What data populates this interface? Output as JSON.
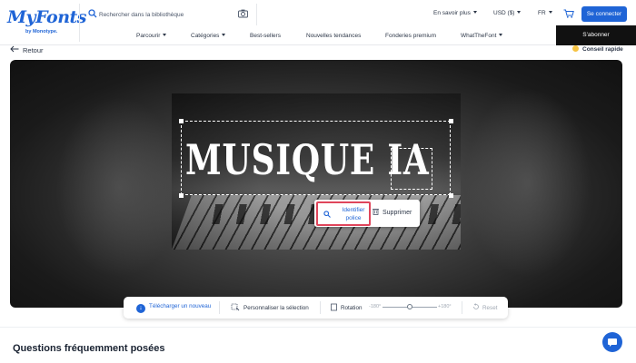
{
  "header": {
    "logo_main": "MyFonts",
    "logo_sub": "by Monotype.",
    "search_placeholder": "Rechercher dans la bibliothèque",
    "learn_more": "En savoir plus",
    "currency": "USD ($)",
    "language": "FR",
    "login": "Se connecter"
  },
  "menu": {
    "items": [
      "Parcourir",
      "Catégories",
      "Best-sellers",
      "Nouvelles tendances",
      "Fonderies premium",
      "WhatTheFont"
    ],
    "subscribe": "S'abonner"
  },
  "nav": {
    "back": "Retour",
    "quick_tip": "Conseil rapide"
  },
  "canvas": {
    "image_text": "MUSIQUE IA",
    "identify_label": "Identifier police",
    "delete_label": "Supprimer"
  },
  "toolbar": {
    "upload": "Télécharger un nouveau",
    "customize": "Personnaliser la sélection",
    "rotation": "Rotation",
    "rot_min": "-180°",
    "rot_max": "+180°",
    "reset": "Reset",
    "rotation_value": 0
  },
  "faq_title": "Questions fréquemment posées",
  "colors": {
    "brand_blue": "#1f64d6",
    "highlight_red": "#e0455b",
    "subscribe_bg": "#111111"
  },
  "icons": [
    "search-icon",
    "camera-icon",
    "cart-icon",
    "back-arrow-icon",
    "lightbulb-icon",
    "magnifier-icon",
    "trash-icon",
    "upload-icon",
    "crop-icon",
    "rotate-icon",
    "reset-icon",
    "chat-icon"
  ]
}
